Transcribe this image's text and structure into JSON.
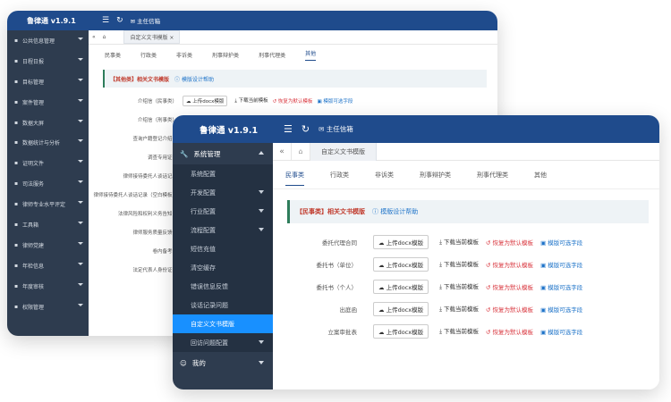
{
  "app": {
    "brand": "鲁律通 v1.9.1",
    "user": "主任信箱"
  },
  "back_window": {
    "tab_label": "自定义文书模版",
    "categories": [
      "民事类",
      "行政类",
      "非诉类",
      "刑事辩护类",
      "刑事代理类",
      "其他"
    ],
    "active_category": "其他",
    "section_title": "【其他类】相关文书模版",
    "section_help": "模版设计帮助",
    "sidebar": [
      "公共信息管理",
      "日程日报",
      "目标管理",
      "案件管理",
      "数据大屏",
      "数据统计与分析",
      "证明文件",
      "司法服务",
      "律师专业水平评定",
      "工具箱",
      "律师党建",
      "年检信息",
      "年度审核",
      "权限管理"
    ],
    "rows": [
      {
        "label": "介绍信（民事类）",
        "upload": "上传docx模版",
        "download": "下载当前模板",
        "reset": "恢复为默认模板",
        "fields": "模版可选字段"
      },
      {
        "label": "介绍信（刑事类）",
        "upload": "",
        "download": "",
        "reset": "",
        "fields": ""
      },
      {
        "label": "查询户籍登记介绍信",
        "upload": "",
        "download": "",
        "reset": "",
        "fields": ""
      },
      {
        "label": "调查专用证明",
        "upload": "",
        "download": "",
        "reset": "",
        "fields": ""
      },
      {
        "label": "律师接待委托人谈话记录",
        "upload": "",
        "download": "",
        "reset": "",
        "fields": ""
      },
      {
        "label": "律师接待委托人谈话记录（空白模板）",
        "upload": "",
        "download": "",
        "reset": "",
        "fields": ""
      },
      {
        "label": "法律风险和权利义务告知书",
        "upload": "",
        "download": "",
        "reset": "",
        "fields": ""
      },
      {
        "label": "律师服务质量反馈卡",
        "upload": "",
        "download": "",
        "reset": "",
        "fields": ""
      },
      {
        "label": "卷内备考表",
        "upload": "",
        "download": "",
        "reset": "",
        "fields": ""
      },
      {
        "label": "法定代表人身份证明",
        "upload": "",
        "download": "",
        "reset": "",
        "fields": ""
      }
    ]
  },
  "front_window": {
    "tab_label": "自定义文书模版",
    "categories": [
      "民事类",
      "行政类",
      "非诉类",
      "刑事辩护类",
      "刑事代理类",
      "其他"
    ],
    "active_category": "民事类",
    "section_title": "【民事类】相关文书模版",
    "section_help": "模版设计帮助",
    "sidebar_group": "系统管理",
    "sidebar_items": [
      "系统配置",
      "开发配置",
      "行业配置",
      "流程配置",
      "短信充值",
      "清空缓存",
      "错误信息反馈",
      "谈话记录问题",
      "自定义文书模版",
      "回访问题配置"
    ],
    "sidebar_active": "自定义文书模版",
    "sidebar_expandable": [
      "开发配置",
      "行业配置",
      "流程配置",
      "回访问题配置"
    ],
    "sidebar_footer": "我的",
    "rows": [
      {
        "label": "委托代理合同",
        "upload": "上传docx模版",
        "download": "下载当前模板",
        "reset": "恢复为默认模板",
        "fields": "模版可选字段"
      },
      {
        "label": "委托书（单位）",
        "upload": "上传docx模版",
        "download": "下载当前模板",
        "reset": "恢复为默认模板",
        "fields": "模版可选字段"
      },
      {
        "label": "委托书（个人）",
        "upload": "上传docx模版",
        "download": "下载当前模板",
        "reset": "恢复为默认模板",
        "fields": "模版可选字段"
      },
      {
        "label": "出庭函",
        "upload": "上传docx模版",
        "download": "下载当前模板",
        "reset": "恢复为默认模板",
        "fields": "模版可选字段"
      },
      {
        "label": "立案审批表",
        "upload": "上传docx模版",
        "download": "下载当前模板",
        "reset": "恢复为默认模板",
        "fields": "模版可选字段"
      }
    ]
  }
}
